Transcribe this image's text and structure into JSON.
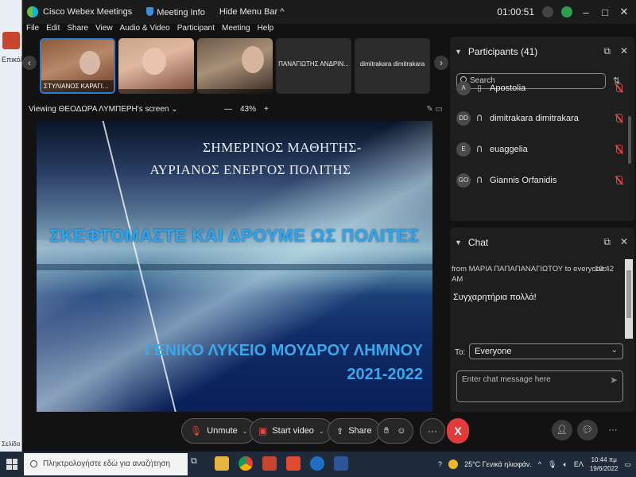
{
  "underlying_app": {
    "label": "Επικόλ",
    "status": "Σελίδα"
  },
  "titlebar": {
    "app_name": "Cisco Webex Meetings",
    "meeting_info": "Meeting Info",
    "hide_menu": "Hide Menu Bar",
    "hide_menu_chevron": "^",
    "timer": "01:00:51"
  },
  "menu": [
    "File",
    "Edit",
    "Share",
    "View",
    "Audio & Video",
    "Participant",
    "Meeting",
    "Help"
  ],
  "thumbnails": [
    {
      "name": "ΣΤΥΛΙΑΝΟΣ ΚΑΡΑΓΙΑΝΝ..."
    },
    {
      "name": ""
    },
    {
      "name": ""
    },
    {
      "name": "ΠΑΝΑΓΙΩΤΗΣ ΑΝΔΡΙΝ..."
    },
    {
      "name": "dimitrakara dimitrakara"
    }
  ],
  "sharing": {
    "viewing": "Viewing ΘΕΟΔΩΡΑ ΛΥΜΠΕΡΗ's screen",
    "zoom_minus": "—",
    "zoom": "43%",
    "zoom_plus": "+"
  },
  "slide": {
    "line1": "ΣΗΜΕΡΙΝΟΣ ΜΑΘΗΤΗΣ-",
    "line2": "ΑΥΡΙΑΝΟΣ ΕΝΕΡΓΟΣ ΠΟΛΙΤΗΣ",
    "headline": "ΣΚΕΦΤΟΜΑΣΤΕ ΚΑΙ ΔΡΟΥΜΕ ΩΣ ΠΟΛΙΤΕΣ",
    "school": "ΓΕΝΙΚΟ ΛΥΚΕΙΟ ΜΟΥΔΡΟΥ ΛΗΜΝΟΥ",
    "year": "2021-2022"
  },
  "participants_panel": {
    "title": "Participants (41)",
    "search_placeholder": "Search",
    "items": [
      {
        "initials": "A",
        "name": "Apostolia"
      },
      {
        "initials": "DD",
        "name": "dimitrakara dimitrakara"
      },
      {
        "initials": "E",
        "name": "euaggelia"
      },
      {
        "initials": "GO",
        "name": "Giannis Orfanidis"
      }
    ]
  },
  "chat_panel": {
    "title": "Chat",
    "from": "from ΜΑΡΙΑ ΠΑΠΑΠΑΝΑΓΙΩΤΟΥ to everyone:",
    "am": "AM",
    "time": "10:42",
    "message": "Συγχαρητήρια πολλά!",
    "to_label": "To:",
    "to_value": "Everyone",
    "input_placeholder": "Enter chat message here"
  },
  "controls": {
    "unmute": "Unmute",
    "start_video": "Start video",
    "share": "Share",
    "more": "···",
    "end": "X"
  },
  "taskbar": {
    "search_placeholder": "Πληκτρολογήστε εδώ για αναζήτηση",
    "weather": "25°C  Γενικά ηλιοφάν.",
    "lang": "ΕΛ",
    "time": "10:44 πμ",
    "date": "19/6/2022"
  },
  "colors": {
    "accent": "#2b7bd1",
    "end_call": "#e23b3b",
    "muted": "#e04848",
    "slide_title": "#2fa6e8"
  }
}
